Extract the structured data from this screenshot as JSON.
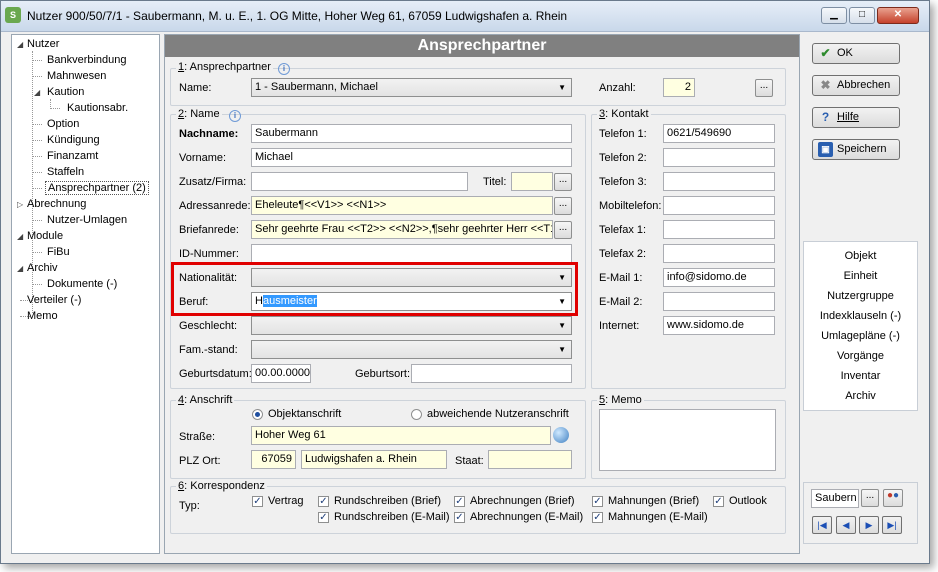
{
  "window": {
    "title": "Nutzer 900/50/7/1 - Saubermann, M. u. E., 1. OG Mitte, Hoher Weg 61, 67059 Ludwigshafen a. Rhein",
    "minimize": "▁",
    "maximize": "□",
    "close": "✕"
  },
  "tree": {
    "items": [
      {
        "label": "Nutzer"
      },
      {
        "label": "Bankverbindung"
      },
      {
        "label": "Mahnwesen"
      },
      {
        "label": "Kaution"
      },
      {
        "label": "Kautionsabr."
      },
      {
        "label": "Option"
      },
      {
        "label": "Kündigung"
      },
      {
        "label": "Finanzamt"
      },
      {
        "label": "Staffeln"
      },
      {
        "label": "Ansprechpartner (2)"
      },
      {
        "label": "Abrechnung"
      },
      {
        "label": "Nutzer-Umlagen"
      },
      {
        "label": "Module"
      },
      {
        "label": "FiBu"
      },
      {
        "label": "Archiv"
      },
      {
        "label": "Dokumente (-)"
      },
      {
        "label": "Verteiler (-)"
      },
      {
        "label": "Memo"
      }
    ]
  },
  "header": {
    "title": "Ansprechpartner"
  },
  "ansprechpartner": {
    "group_num": "1",
    "group_label": ": Ansprechpartner",
    "name_label": "Name:",
    "name_value": "1 - Saubermann, Michael",
    "anzahl_label": "Anzahl:",
    "anzahl_value": "2",
    "dots": "..."
  },
  "name_group": {
    "group_num": "2",
    "group_label": ": Name",
    "nachname_label": "Nachname:",
    "nachname_value": "Saubermann",
    "vorname_label": "Vorname:",
    "vorname_value": "Michael",
    "zusatz_label": "Zusatz/Firma:",
    "zusatz_value": "",
    "titel_label": "Titel:",
    "titel_value": "",
    "adressanrede_label": "Adressanrede:",
    "adressanrede_value": "Eheleute¶<<V1>> <<N1>>",
    "briefanrede_label": "Briefanrede:",
    "briefanrede_value": "Sehr geehrte Frau <<T2>> <<N2>>,¶sehr geehrter Herr <<T1>",
    "idnummer_label": "ID-Nummer:",
    "idnummer_value": "",
    "nationalitaet_label": "Nationalität:",
    "nationalitaet_value": "",
    "beruf_label": "Beruf:",
    "beruf_value_first": "H",
    "beruf_value_rest": "ausmeister",
    "geschlecht_label": "Geschlecht:",
    "famstand_label": "Fam.-stand:",
    "geburtsdatum_label": "Geburtsdatum:",
    "geburtsdatum_value": "00.00.0000",
    "geburtsort_label": "Geburtsort:",
    "geburtsort_value": ""
  },
  "kontakt": {
    "group_num": "3",
    "group_label": ": Kontakt",
    "rows": [
      {
        "label": "Telefon 1:",
        "value": "0621/549690"
      },
      {
        "label": "Telefon 2:",
        "value": ""
      },
      {
        "label": "Telefon 3:",
        "value": ""
      },
      {
        "label": "Mobiltelefon:",
        "value": ""
      },
      {
        "label": "Telefax 1:",
        "value": ""
      },
      {
        "label": "Telefax 2:",
        "value": ""
      },
      {
        "label": "E-Mail 1:",
        "value": "info@sidomo.de"
      },
      {
        "label": "E-Mail 2:",
        "value": ""
      },
      {
        "label": "Internet:",
        "value": "www.sidomo.de"
      }
    ]
  },
  "anschrift": {
    "group_num": "4",
    "group_label": ": Anschrift",
    "radio1": "Objektanschrift",
    "radio2": "abweichende Nutzeranschrift",
    "strasse_label": "Straße:",
    "strasse_value": "Hoher Weg 61",
    "plz_label": "PLZ Ort:",
    "plz_value": "67059",
    "ort_value": "Ludwigshafen a. Rhein",
    "staat_label": "Staat:",
    "staat_value": ""
  },
  "memo": {
    "group_num": "5",
    "group_label": ": Memo"
  },
  "korrespondenz": {
    "group_num": "6",
    "group_label": ": Korrespondenz",
    "typ_label": "Typ:",
    "checks": [
      "Vertrag",
      "Rundschreiben (Brief)",
      "Abrechnungen (Brief)",
      "Mahnungen (Brief)",
      "Outlook",
      "Rundschreiben (E-Mail)",
      "Abrechnungen (E-Mail)",
      "Mahnungen (E-Mail)"
    ],
    "checkmark": "✓"
  },
  "buttons": {
    "ok": "OK",
    "abbrechen": "Abbrechen",
    "hilfe": "Hilfe",
    "speichern": "Speichern"
  },
  "links": [
    "Objekt",
    "Einheit",
    "Nutzergruppe",
    "Indexklauseln (-)",
    "Umlagepläne (-)",
    "Vorgänge",
    "Inventar",
    "Archiv"
  ],
  "navigation": {
    "search_value": "Saubern",
    "dots": "...",
    "first": "|◀",
    "prev": "◀",
    "next": "▶",
    "last": "▶|"
  },
  "icons": {
    "ok": "check-icon",
    "abbrechen": "cancel-icon",
    "hilfe": "help-icon",
    "speichern": "save-icon",
    "info": "info-icon",
    "globe": "globe-icon",
    "people": "people-icon"
  },
  "colors": {
    "header_bg": "#808080",
    "highlight_box": "#e00000",
    "input_yellow": "#ffffe1",
    "selection": "#3399ff"
  }
}
